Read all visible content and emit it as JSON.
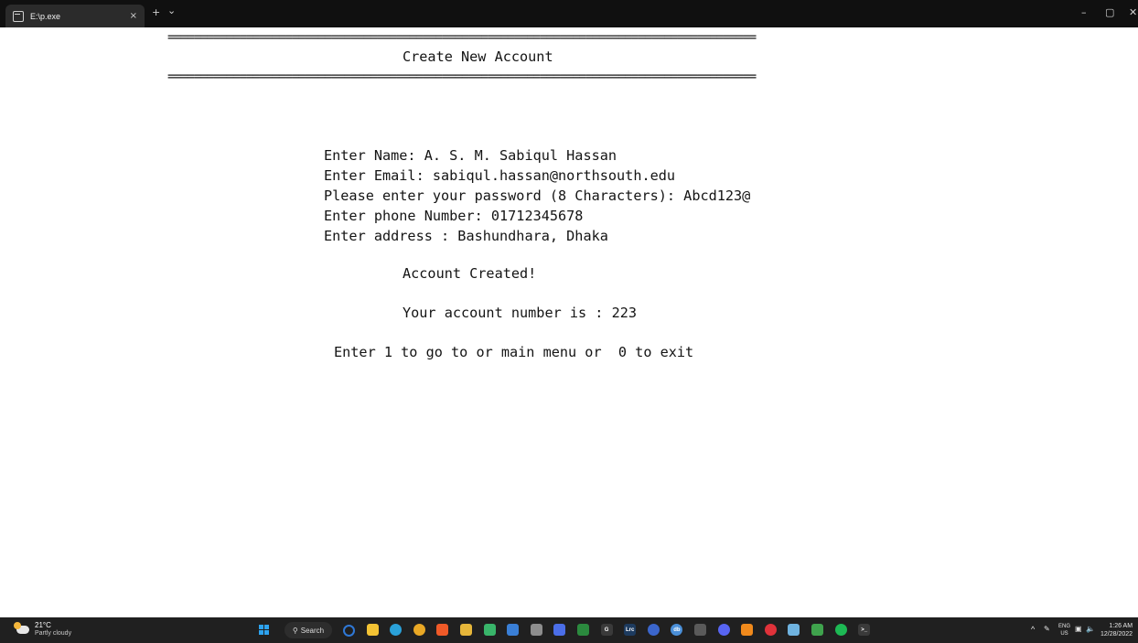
{
  "window": {
    "tab_title": "E:\\p.exe",
    "tab_close": "×",
    "new_tab": "+",
    "tab_dropdown": "⌄",
    "minimize": "–",
    "maximize": "▢",
    "close": "✕"
  },
  "console": {
    "rule_top": "==========================================================================================",
    "heading": "Create New Account",
    "rule_bottom": "==========================================================================================",
    "lines": [
      "Enter Name: A. S. M. Sabiqul Hassan",
      "Enter Email: sabiqul.hassan@northsouth.edu",
      "Please enter your password (8 Characters): Abcd123@",
      "Enter phone Number: 01712345678",
      "Enter address : Bashundhara, Dhaka"
    ],
    "account_created": "Account Created!",
    "account_number": "Your account number is : 223",
    "menu_prompt": "Enter 1 to go to or main menu or  0 to exit"
  },
  "taskbar": {
    "weather_temp": "21°C",
    "weather_condition": "Partly cloudy",
    "search_label": "Search",
    "apps": [
      {
        "name": "cortana-icon",
        "color": "#2f78d6",
        "glyph": ""
      },
      {
        "name": "file-explorer-icon",
        "color": "#f3c334",
        "glyph": ""
      },
      {
        "name": "edge-icon",
        "color": "#2aa1d9",
        "glyph": ""
      },
      {
        "name": "chrome-icon",
        "color": "#e9a825",
        "glyph": ""
      },
      {
        "name": "brave-icon",
        "color": "#f05a28",
        "glyph": ""
      },
      {
        "name": "paint-icon",
        "color": "#e6b63a",
        "glyph": ""
      },
      {
        "name": "app-icon-7",
        "color": "#39b56a",
        "glyph": ""
      },
      {
        "name": "store-icon",
        "color": "#3a7fd6",
        "glyph": ""
      },
      {
        "name": "app-icon-9",
        "color": "#8d8d8d",
        "glyph": ""
      },
      {
        "name": "app-icon-10",
        "color": "#4b6ee8",
        "glyph": ""
      },
      {
        "name": "xbox-icon",
        "color": "#2b8a3e",
        "glyph": ""
      },
      {
        "name": "app-icon-12",
        "color": "#3a3a3a",
        "glyph": "G"
      },
      {
        "name": "lightroom-icon",
        "color": "#1d3b5f",
        "glyph": "Lrc"
      },
      {
        "name": "app-icon-14",
        "color": "#3b66cc",
        "glyph": ""
      },
      {
        "name": "app-icon-15",
        "color": "#4a8fd8",
        "glyph": "db"
      },
      {
        "name": "app-icon-16",
        "color": "#5a5a5a",
        "glyph": ""
      },
      {
        "name": "discord-icon",
        "color": "#5865f2",
        "glyph": ""
      },
      {
        "name": "vlc-icon",
        "color": "#f08a1c",
        "glyph": ""
      },
      {
        "name": "app-icon-19",
        "color": "#e0323a",
        "glyph": ""
      },
      {
        "name": "app-icon-20",
        "color": "#6fb3e0",
        "glyph": ""
      },
      {
        "name": "app-icon-21",
        "color": "#3fa34d",
        "glyph": ""
      },
      {
        "name": "spotify-icon",
        "color": "#1db954",
        "glyph": ""
      },
      {
        "name": "terminal-icon",
        "color": "#3a3a3a",
        "glyph": ">_"
      }
    ],
    "tray_chevron": "^",
    "lang_top": "ENG",
    "lang_bottom": "US",
    "time": "1:26 AM",
    "date": "12/28/2022"
  },
  "colors": {
    "console_bg": "#ffffff",
    "console_text": "#141414",
    "titlebar_bg": "#101010",
    "taskbar_bg": "#202020"
  }
}
